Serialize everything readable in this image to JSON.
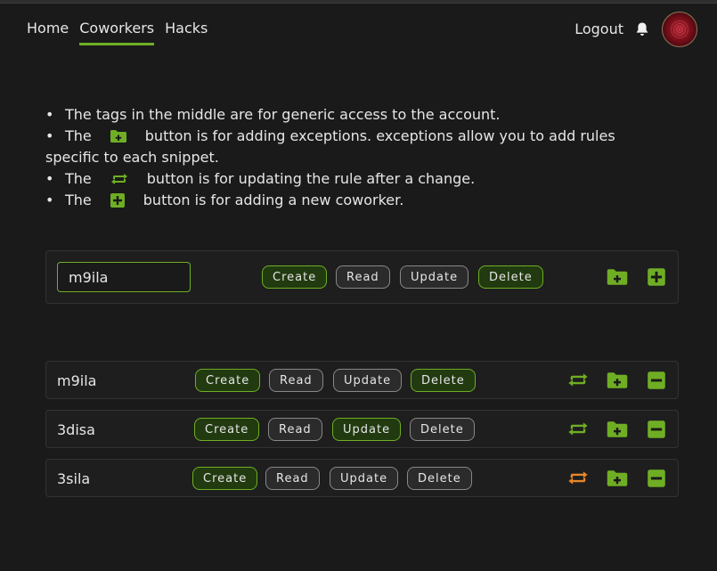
{
  "nav": {
    "home": "Home",
    "coworkers": "Coworkers",
    "hacks": "Hacks",
    "logout": "Logout"
  },
  "info": {
    "line1": "The tags in the middle are for generic access to the account.",
    "line2_pre": "The",
    "line2_post": "button is for adding exceptions. exceptions allow you to add rules specific to each snippet.",
    "line3_pre": "The",
    "line3_post": "button is for updating the rule after a change.",
    "line4_pre": "The",
    "line4_post": "button is for adding a new coworker.",
    "bullet": "•"
  },
  "new_coworker": {
    "input_value": "m9ila",
    "perms": [
      {
        "label": "Create",
        "on": true
      },
      {
        "label": "Read",
        "on": false
      },
      {
        "label": "Update",
        "on": false
      },
      {
        "label": "Delete",
        "on": true
      }
    ]
  },
  "coworkers": [
    {
      "name": "m9ila",
      "update_color": "#6fae24",
      "perms": [
        {
          "label": "Create",
          "on": true
        },
        {
          "label": "Read",
          "on": false
        },
        {
          "label": "Update",
          "on": false
        },
        {
          "label": "Delete",
          "on": true
        }
      ]
    },
    {
      "name": "3disa",
      "update_color": "#6fae24",
      "perms": [
        {
          "label": "Create",
          "on": true
        },
        {
          "label": "Read",
          "on": true
        },
        {
          "label": "Update",
          "on": true
        },
        {
          "label": "Delete",
          "on": false
        }
      ]
    },
    {
      "name": "3sila",
      "update_color": "#e8862a",
      "perms": [
        {
          "label": "Create",
          "on": true
        },
        {
          "label": "Read",
          "on": false
        },
        {
          "label": "Update",
          "on": false
        },
        {
          "label": "Delete",
          "on": false
        }
      ]
    }
  ],
  "colors": {
    "accent": "#6fae24",
    "pending": "#e8862a",
    "background": "#1a1a1a"
  },
  "icons": {
    "add_exception": "folder-plus-icon",
    "update": "repeat-icon",
    "add_coworker": "plus-square-icon",
    "remove_coworker": "minus-square-icon",
    "notifications": "bell-icon"
  }
}
